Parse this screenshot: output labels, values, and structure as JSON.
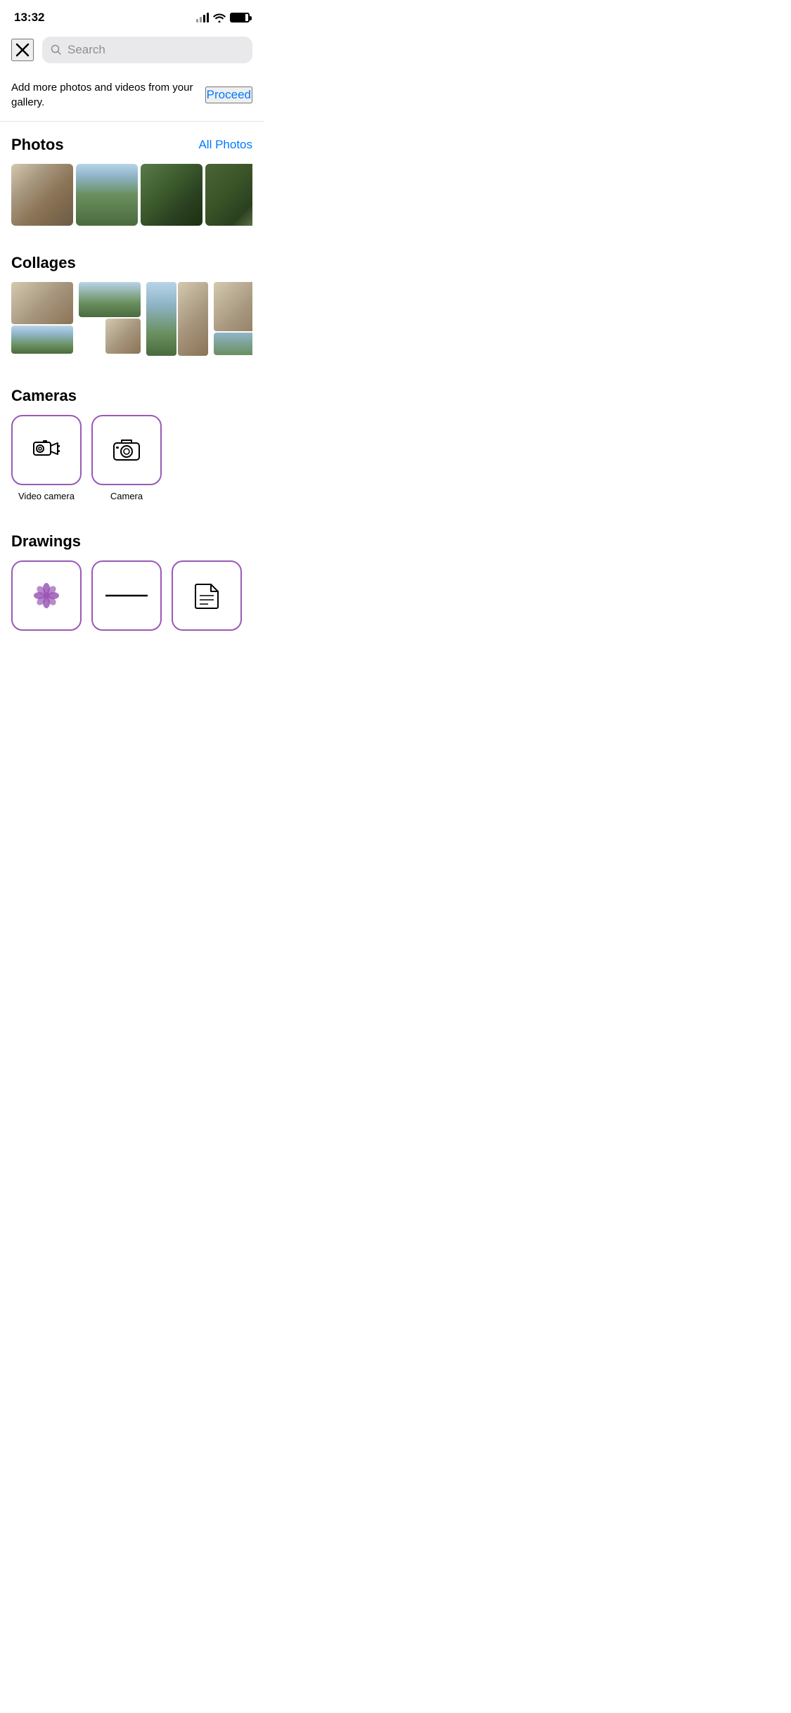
{
  "statusBar": {
    "time": "13:32",
    "signalBars": [
      5,
      8,
      11,
      14
    ],
    "signalActive": 2
  },
  "topNav": {
    "closeLabel": "×",
    "searchPlaceholder": "Search"
  },
  "banner": {
    "text": "Add more photos and videos from your gallery.",
    "proceedLabel": "Proceed"
  },
  "photosSection": {
    "title": "Photos",
    "allPhotosLabel": "All Photos",
    "photos": [
      {
        "id": 1,
        "alt": "desk with chair by window"
      },
      {
        "id": 2,
        "alt": "green field with cloudy sky"
      },
      {
        "id": 3,
        "alt": "dense tree branches"
      },
      {
        "id": 4,
        "alt": "garden foliage"
      }
    ]
  },
  "collagesSection": {
    "title": "Collages",
    "collages": [
      {
        "id": 1
      },
      {
        "id": 2
      },
      {
        "id": 3
      },
      {
        "id": 4
      }
    ]
  },
  "camerasSection": {
    "title": "Cameras",
    "cameras": [
      {
        "id": "video",
        "label": "Video camera"
      },
      {
        "id": "photo",
        "label": "Camera"
      }
    ]
  },
  "drawingsSection": {
    "title": "Drawings",
    "drawings": [
      {
        "id": "flower"
      },
      {
        "id": "line"
      },
      {
        "id": "document"
      }
    ]
  }
}
